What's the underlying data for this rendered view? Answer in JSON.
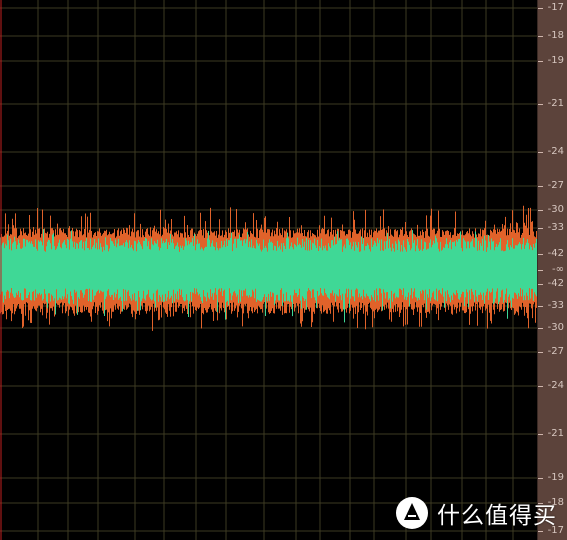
{
  "waveform": {
    "colors": {
      "background": "#000000",
      "grid": "#3d3a22",
      "center_line": "#c02020",
      "channel_top": "#e0622a",
      "channel_bottom": "#3fd896",
      "ruler_background": "#5c433b",
      "ruler_text": "#d6c6bf"
    }
  },
  "db_scale": {
    "labels": [
      {
        "value": "-17"
      },
      {
        "value": "-18"
      },
      {
        "value": "-19"
      },
      {
        "value": "-21"
      },
      {
        "value": "-24"
      },
      {
        "value": "-27"
      },
      {
        "value": "-30"
      },
      {
        "value": "-33"
      },
      {
        "value": "-42"
      },
      {
        "value": "-∞"
      },
      {
        "value": "-42"
      },
      {
        "value": "-33"
      },
      {
        "value": "-30"
      },
      {
        "value": "-27"
      },
      {
        "value": "-24"
      },
      {
        "value": "-21"
      },
      {
        "value": "-19"
      },
      {
        "value": "-18"
      },
      {
        "value": "-17"
      }
    ]
  },
  "watermark": {
    "logo_icon": "zhi-logo-icon",
    "text": "什么值得买"
  }
}
